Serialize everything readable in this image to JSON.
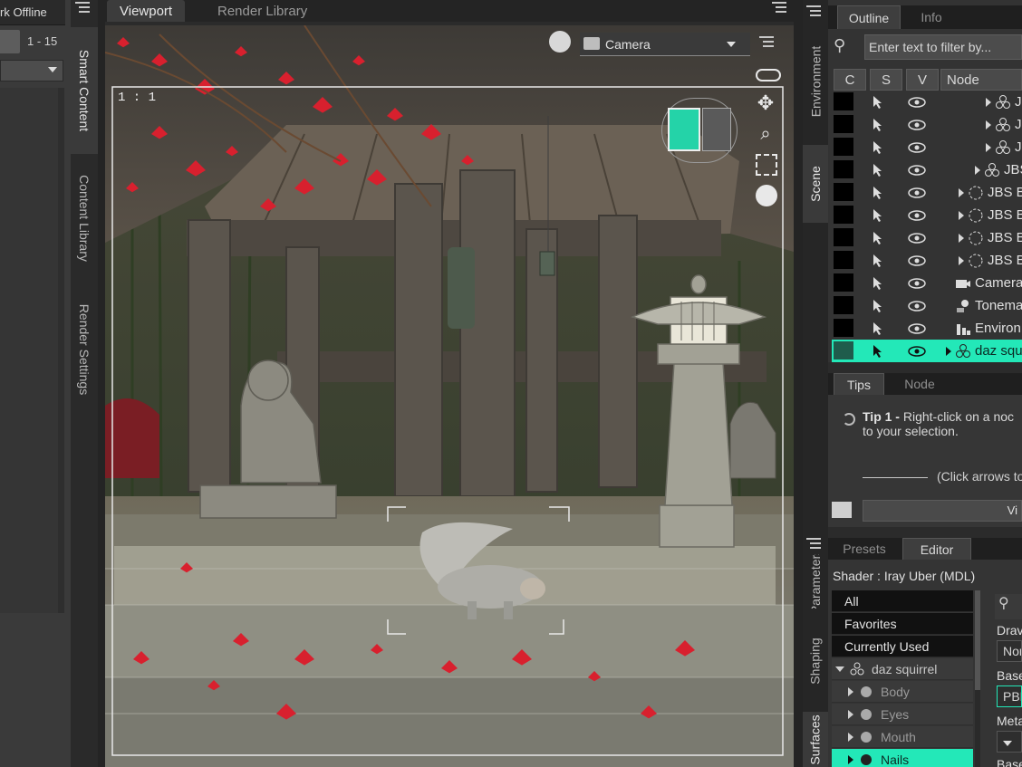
{
  "left_pane": {
    "status": "rk Offline",
    "range": "1 - 15",
    "rail_tabs": [
      "Smart Content",
      "Content Library",
      "Render Settings"
    ]
  },
  "viewport": {
    "tabs": [
      "Viewport",
      "Render Library"
    ],
    "camera": "Camera",
    "aspect": "1 : 1"
  },
  "right_rail_tabs": [
    "Environment",
    "Scene",
    "Parameters",
    "Shaping",
    "Surfaces"
  ],
  "outline": {
    "tabs": [
      "Outline",
      "Info"
    ],
    "filter_placeholder": "Enter text to filter by...",
    "columns": [
      "C",
      "S",
      "V",
      "Node"
    ],
    "rows": [
      {
        "label": "JB",
        "icon": "group-icon",
        "indent": 4
      },
      {
        "label": "JB",
        "icon": "group-icon",
        "indent": 4
      },
      {
        "label": "JB",
        "icon": "group-icon",
        "indent": 4
      },
      {
        "label": "JBS",
        "icon": "group-icon",
        "indent": 3
      },
      {
        "label": "JBS Ba",
        "icon": "null-icon",
        "indent": 2
      },
      {
        "label": "JBS Ba",
        "icon": "null-icon",
        "indent": 2
      },
      {
        "label": "JBS Ba",
        "icon": "null-icon",
        "indent": 2
      },
      {
        "label": "JBS Ba",
        "icon": "null-icon",
        "indent": 2
      },
      {
        "label": "Camera",
        "icon": "camera-icon",
        "indent": 0
      },
      {
        "label": "Tonema",
        "icon": "tonemapper-icon",
        "indent": 0
      },
      {
        "label": "Environ",
        "icon": "environment-icon",
        "indent": 0
      },
      {
        "label": "daz squ",
        "icon": "figure-icon",
        "indent": 1,
        "selected": true
      }
    ]
  },
  "tips": {
    "tabs": [
      "Tips",
      "Node"
    ],
    "tip_title": "Tip 1 -",
    "tip_body_line1": " Right-click on a noc",
    "tip_body_line2": "to your selection.",
    "hint": "(Click arrows to",
    "button": "Vi"
  },
  "surfaces": {
    "tabs": [
      "Presets",
      "Editor"
    ],
    "shader_label": "Shader :  Iray Uber (MDL)",
    "categories": [
      "All",
      "Favorites",
      "Currently Used"
    ],
    "figure": "daz squirrel",
    "nodes": [
      "Body",
      "Eyes",
      "Mouth",
      "Nails"
    ],
    "selected_node": "Nails",
    "props": {
      "draw_label": "Drav",
      "draw_value": "Nor",
      "base_label": "Base",
      "base_value": "PBR",
      "meta_label": "Meta",
      "base2_label": "Base"
    }
  },
  "colors": {
    "accent": "#23e8b8",
    "panel": "#333333",
    "leaf_red": "#d8202e"
  }
}
